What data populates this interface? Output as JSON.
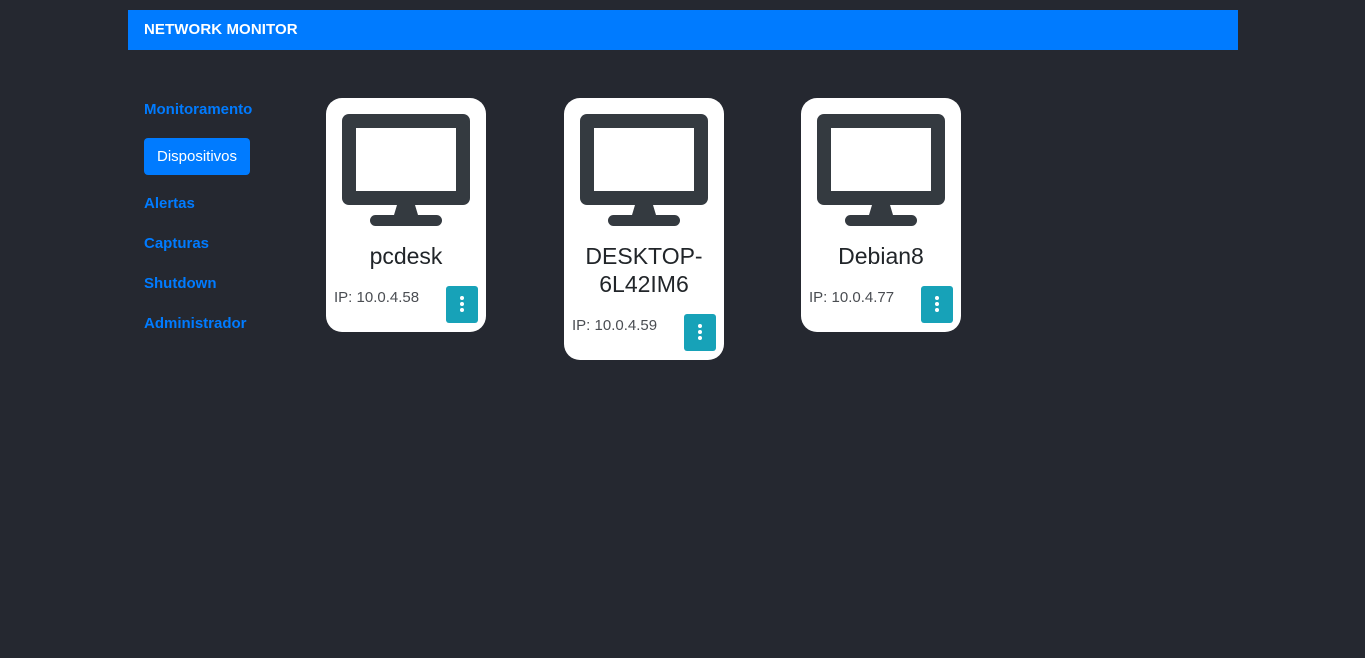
{
  "header": {
    "brand": "NETWORK MONITOR"
  },
  "sidebar": {
    "items": [
      {
        "label": "Monitoramento",
        "active": false
      },
      {
        "label": "Dispositivos",
        "active": true
      },
      {
        "label": "Alertas",
        "active": false
      },
      {
        "label": "Capturas",
        "active": false
      },
      {
        "label": "Shutdown",
        "active": false
      },
      {
        "label": "Administrador",
        "active": false
      }
    ]
  },
  "devices": [
    {
      "name": "pcdesk",
      "ip": "IP: 10.0.4.58",
      "icon": "desktop-monitor-icon"
    },
    {
      "name": "DESKTOP-6L42IM6",
      "ip": "IP: 10.0.4.59",
      "icon": "desktop-monitor-icon"
    },
    {
      "name": "Debian8",
      "ip": "IP: 10.0.4.77",
      "icon": "desktop-monitor-icon"
    }
  ],
  "colors": {
    "background": "#252830",
    "primary": "#007bff",
    "card": "#ffffff",
    "icon": "#343a40",
    "menu_button": "#17a2b8"
  }
}
